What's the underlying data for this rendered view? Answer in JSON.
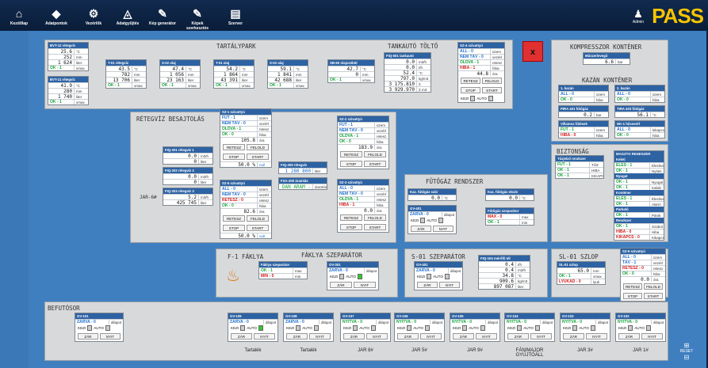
{
  "nav": [
    {
      "label": "Kezdőlap",
      "icon": "home-icon",
      "glyph": "⌂"
    },
    {
      "label": "Adatpontok",
      "icon": "tag-icon",
      "glyph": "◆"
    },
    {
      "label": "Vezérlők",
      "icon": "gears-icon",
      "glyph": "⚙"
    },
    {
      "label": "Adatgyűjtés",
      "icon": "chart-icon",
      "glyph": "◬"
    },
    {
      "label": "Kép generátor",
      "icon": "wand-icon",
      "glyph": "✎"
    },
    {
      "label": "Képek szerkesztés",
      "icon": "edit-icon",
      "glyph": "✎"
    },
    {
      "label": "Szerver",
      "icon": "server-icon",
      "glyph": "▤"
    }
  ],
  "user": {
    "label": "Admin"
  },
  "brand": "PASS",
  "close_label": "x",
  "reset_label": "RESET",
  "sections": {
    "tartalypark": "TARTÁLYPARK",
    "tankauto": "TANKAUTÓ TÖLTŐ",
    "kompresszor": "KOMPRESSZOR KONTÉNER",
    "kazan": "KAZÁN KONTÉNER",
    "retegviz": "RÉTEGVÍZ BESAJTOLÁS",
    "futogaz": "FŰTŐGÁZ RENDSZER",
    "biztonsag": "BIZTONSÁG",
    "faklya": "F-1 FÁKLYA",
    "faklya_szep": "FÁKLYA SZEPARÁTOR",
    "s01": "S-01 SZEPARÁTOR",
    "sl01": "SL-01 SZLOP",
    "befuto": "BEFUTÓSOR",
    "jar6": "JAR-6#"
  },
  "bvt12": {
    "title": "BVT-12 rétegvíz",
    "rows": [
      [
        "25.6",
        "°C"
      ],
      [
        "252",
        "mm"
      ],
      [
        "1 624",
        "liter"
      ]
    ],
    "status": "OK - 1",
    "unit": "vmax"
  },
  "bvt11": {
    "title": "BVT-11 rétegvíz",
    "rows": [
      [
        "41.9",
        "°C"
      ],
      [
        "280",
        "mm"
      ],
      [
        "1 740",
        "liter"
      ]
    ],
    "status": "OK - 1",
    "unit": "vmax"
  },
  "tanks": [
    {
      "title": "T-01 rétegvíz",
      "rows": [
        [
          "43.5",
          "°C"
        ],
        [
          "782",
          "mm"
        ],
        [
          "13 706",
          "liter"
        ]
      ],
      "status": "OK - 1",
      "unit": "vmax"
    },
    {
      "title": "S-02 olaj",
      "rows": [
        [
          "47.4",
          "°C"
        ],
        [
          "1 056",
          "mm"
        ],
        [
          "23 163",
          "liter"
        ]
      ],
      "status": "OK - 1",
      "unit": "vmax"
    },
    {
      "title": "T-01 olaj",
      "rows": [
        [
          "54.2",
          "°C"
        ],
        [
          "1 864",
          "mm"
        ],
        [
          "43 391",
          "liter"
        ]
      ],
      "status": "OK - 1",
      "unit": "vmax"
    },
    {
      "title": "S-02 olaj",
      "rows": [
        [
          "59.1",
          "°C"
        ],
        [
          "1 841",
          "mm"
        ],
        [
          "42 688",
          "liter"
        ]
      ],
      "status": "OK - 1",
      "unit": "vmax"
    }
  ],
  "sb": {
    "title": "SB-60 olajcsöböl",
    "rows": [
      [
        "42.7",
        "°C"
      ],
      [
        "0",
        "mm"
      ]
    ],
    "status": "OK - 1",
    "unit": "vmax"
  },
  "fiq501": {
    "title": "FIQ-501 tankautó",
    "rows": [
      [
        "0.0",
        "m3/h"
      ],
      [
        "0.0",
        "t/h"
      ],
      [
        "52.4",
        "°C"
      ],
      [
        "797.0",
        "kg/m3"
      ],
      [
        "3 175.810",
        "Σ tonna"
      ],
      [
        "3 929.970",
        "Σ m3"
      ]
    ]
  },
  "sz4": {
    "title": "SZ-4 szivattyú",
    "s": [
      [
        "ALL - 0",
        "üzem",
        "blue"
      ],
      [
        "NEM TÁV - 0",
        "vezérl",
        "blue"
      ],
      [
        "OLDVA - 1",
        "retesz",
        "green"
      ],
      [
        "HIBA - 1",
        "hiba",
        "red"
      ]
    ],
    "val": "44.8",
    "vu": "óra",
    "b1": "RETESZ",
    "b2": "FELOLD",
    "b3": "STOP",
    "b4": "START",
    "k": "KEZI",
    "a": "AUTO"
  },
  "kompr": {
    "title": "Műszerlevegő",
    "val": "6.6",
    "unit": "bar"
  },
  "kazan1": {
    "title": "1. kazán",
    "s": [
      [
        "ALL - 0",
        "üzem",
        "blue"
      ],
      [
        "OK - 0",
        "hiba",
        "green"
      ]
    ]
  },
  "kazan2": {
    "title": "2. kazán",
    "s": [
      [
        "ALL - 0",
        "üzem",
        "blue"
      ],
      [
        "OK - 0",
        "hiba",
        "green"
      ]
    ]
  },
  "pira401": {
    "title": "PIRA 401 fűtőgáz",
    "val": "0.2",
    "unit": "bar"
  },
  "tira": {
    "title": "TIRA 403 fűtőgáz",
    "val": "56.1",
    "unit": "°C"
  },
  "villamos": {
    "title": "Villamos fűtések",
    "s": [
      [
        "FUT - 1",
        "üzem",
        "green"
      ],
      [
        "HIBA - 0",
        "hiba",
        "red"
      ]
    ]
  },
  "nk1": {
    "title": "NK-1 hőcserél",
    "s": [
      [
        "ALL - 0",
        "kikapcsolt",
        "blue"
      ],
      [
        "OK - 0",
        "hiba",
        "green"
      ]
    ]
  },
  "sz1": {
    "title": "SZ-1 szivattyú",
    "s": [
      [
        "FUT - 1",
        "üzem",
        "blue"
      ],
      [
        "NEM TÁV - 0",
        "vezérl",
        "blue"
      ],
      [
        "OLDVA - 1",
        "retesz",
        "green"
      ],
      [
        "OK - 0",
        "hiba",
        "green"
      ]
    ],
    "val": "105.8",
    "vu": "óra",
    "b1": "RETESZ",
    "b2": "FELOLD",
    "b3": "STOP",
    "b4": "START",
    "pct": "50.0 %",
    "nul": "null"
  },
  "sz2": {
    "title": "SZ-2 szivattyú",
    "s": [
      [
        "FUT - 1",
        "üzem",
        "blue"
      ],
      [
        "NEM TÁV - 0",
        "vezérl",
        "blue"
      ],
      [
        "OLDVA - 1",
        "retesz",
        "green"
      ],
      [
        "OK - 0",
        "hiba",
        "green"
      ]
    ],
    "val": "183.9",
    "vu": "óra",
    "b1": "RETESZ",
    "b2": "FELOLD",
    "b3": "STOP",
    "b4": "START"
  },
  "sz5": {
    "title": "SZ-5 szivattyú",
    "s": [
      [
        "ALL - 0",
        "üzem",
        "blue"
      ],
      [
        "NEM TÁV - 0",
        "vezérl",
        "blue"
      ],
      [
        "RETESZ - 0",
        "retesz",
        "red"
      ],
      [
        "OK - 0",
        "hiba",
        "green"
      ]
    ],
    "val": "82.6",
    "vu": "óra",
    "b1": "RETESZ",
    "b2": "FELOLD",
    "b3": "STOP",
    "b4": "START",
    "pct": "50.0 %",
    "nul": "null"
  },
  "sz3": {
    "title": "SZ-3 szivattyú",
    "s": [
      [
        "ALL - 0",
        "üzem",
        "blue"
      ],
      [
        "NEM TÁV - 0",
        "vezérl",
        "blue"
      ],
      [
        "OLDVA - 1",
        "retesz",
        "green"
      ],
      [
        "HIBA - 1",
        "hiba",
        "red"
      ]
    ],
    "val": "0.0",
    "vu": "óra",
    "b1": "RETESZ",
    "b2": "FELOLD",
    "b3": "STOP",
    "b4": "START"
  },
  "fiq201": {
    "title": "FIQ-201 rétegvíz 1",
    "rows": [
      [
        "0.0",
        "m3/h"
      ],
      [
        "0",
        "liter"
      ]
    ]
  },
  "fiq202": {
    "title": "FIQ-202 rétegvíz 2",
    "rows": [
      [
        "0.0",
        "m3/h"
      ],
      [
        "0",
        "liter"
      ]
    ]
  },
  "fiq203": {
    "title": "FIQ-203 rétegvíz 3",
    "rows": [
      [
        "5.2",
        "m3/h"
      ],
      [
        "425 745",
        "liter"
      ]
    ]
  },
  "fiq200": {
    "title": "FIQ-200 rétegvíz",
    "val": "1 280 800",
    "unit": "liter"
  },
  "fsa": {
    "title": "FSA-200 áramlás",
    "val": "DAN ÁRAM - 1",
    "unit": "áramlás"
  },
  "kazfit": {
    "title": "Kaz. fűtőgáz szűr",
    "val": "0.0",
    "unit": "°C"
  },
  "fut2": {
    "title": "Kaz. fűtőgáz elszív",
    "val": "0.0",
    "unit": "°C"
  },
  "gv401": {
    "title": "GV-401",
    "s": "ZÁRVA - 0",
    "st": "állapot",
    "k": "KEZI",
    "a": "AUTO",
    "z": "ZÁR",
    "n": "NYIT"
  },
  "futszep": {
    "title": "Fűtőgáz szeparátor",
    "s": [
      [
        "MAX - 0",
        "max",
        "red"
      ],
      [
        "OK - 1",
        "min",
        "green"
      ]
    ]
  },
  "biz": {
    "title": "Tűzjelző rendszer",
    "s": [
      [
        "FUT - 1",
        "TŰZ"
      ],
      [
        "OK - 1",
        "HIBA"
      ],
      [
        "OK - 1",
        "KIKAPCS"
      ]
    ]
  },
  "mtr": {
    "title": "MAGZTO RENDSZER",
    "groups": [
      [
        "Keleti",
        "ÉLES - 1",
        "Élesítve",
        "OK - 1",
        "Nyitás"
      ],
      [
        "Nyugat",
        "OK - 1",
        "Nyugat",
        "OK - 1",
        "Kabát"
      ],
      [
        "Konténer",
        "ÉLES - 1",
        "Élesítve",
        "OK - 1",
        "Alarm"
      ],
      [
        "Parkoló",
        "OK - 1",
        "Pánik"
      ],
      [
        "Rendszer",
        "OK - 1",
        "Szabot",
        "HIBA - 0",
        "Hiba",
        "KIKAPCS - 0",
        "Kikapcs"
      ]
    ]
  },
  "faklya_szep": {
    "title": "Fáklya szeparátor",
    "s": [
      [
        "OK - 1",
        "max",
        "green"
      ],
      [
        "MIN - 0",
        "min",
        "red"
      ]
    ]
  },
  "gv301": {
    "title": "GV-301",
    "s": "ZÁRVA - 0",
    "st": "állapot",
    "k": "KEZI",
    "a": "AUTO",
    "z": "ZÁR",
    "n": "NYIT"
  },
  "gv401b": {
    "title": "GV-401",
    "s": "ZÁRVA - 0",
    "st": "állapot",
    "k": "KEZI",
    "a": "AUTO",
    "z": "ZÁR",
    "n": "NYIT"
  },
  "fiq104": {
    "title": "FIQ-104 mérőfő tél",
    "rows": [
      [
        "0.4",
        "t/h"
      ],
      [
        "0.4",
        "m3/h"
      ],
      [
        "34.8",
        "°C"
      ],
      [
        "909.6",
        "kg/m3"
      ],
      [
        "897 087",
        "liter"
      ]
    ]
  },
  "sl01": {
    "title": "SL-01 szlop",
    "rows": [
      [
        "65.0",
        "mm"
      ],
      [
        "OK - 1",
        "vmax"
      ],
      [
        "LYUKAD - 0",
        "lyuk"
      ]
    ]
  },
  "sz6": {
    "title": "SZ-6 szivattyú",
    "s": [
      [
        "ALL - 0",
        "üzem",
        "blue"
      ],
      [
        "TÁV - 1",
        "vezérl",
        "blue"
      ],
      [
        "RETESZ - 0",
        "retesz",
        "red"
      ],
      [
        "OK - 0",
        "hiba",
        "green"
      ]
    ],
    "val": "0.0",
    "vu": "óra",
    "b1": "RETESZ",
    "b2": "FELOLD",
    "b3": "STOP",
    "b4": "START"
  },
  "gv101": {
    "title": "GV-101",
    "s": "ZÁRVA - 0",
    "st": "állapot",
    "k": "KEZI",
    "a": "AUTO",
    "z": "ZÁR",
    "n": "NYIT"
  },
  "valves": [
    {
      "title": "GV-109",
      "s": "ZÁRVA - 0",
      "cap": "Tartalék"
    },
    {
      "title": "GV-108",
      "s": "ZÁRVA - 0",
      "cap": "Tartalék"
    },
    {
      "title": "GV-107",
      "s": "NYITVA - 0",
      "cap": "JAR 8#"
    },
    {
      "title": "GV-106",
      "s": "NYITVA - 0",
      "cap": "JAR 5#"
    },
    {
      "title": "GV-105",
      "s": "NYITVA - 0",
      "cap": "JAR 9#"
    },
    {
      "title": "GV-104",
      "s": "NYITVA - 0",
      "cap": "FÁNIMAJOR GYŰJTŐÁLL"
    },
    {
      "title": "GV-103",
      "s": "NYITVA - 0",
      "cap": "JAR 3#"
    },
    {
      "title": "GV-102",
      "s": "NYITVA - 0",
      "cap": "JAR 1#"
    }
  ],
  "valve_labels": {
    "st": "állapot",
    "k": "KEZI",
    "a": "AUTO",
    "z": "ZÁR",
    "n": "NYIT"
  }
}
